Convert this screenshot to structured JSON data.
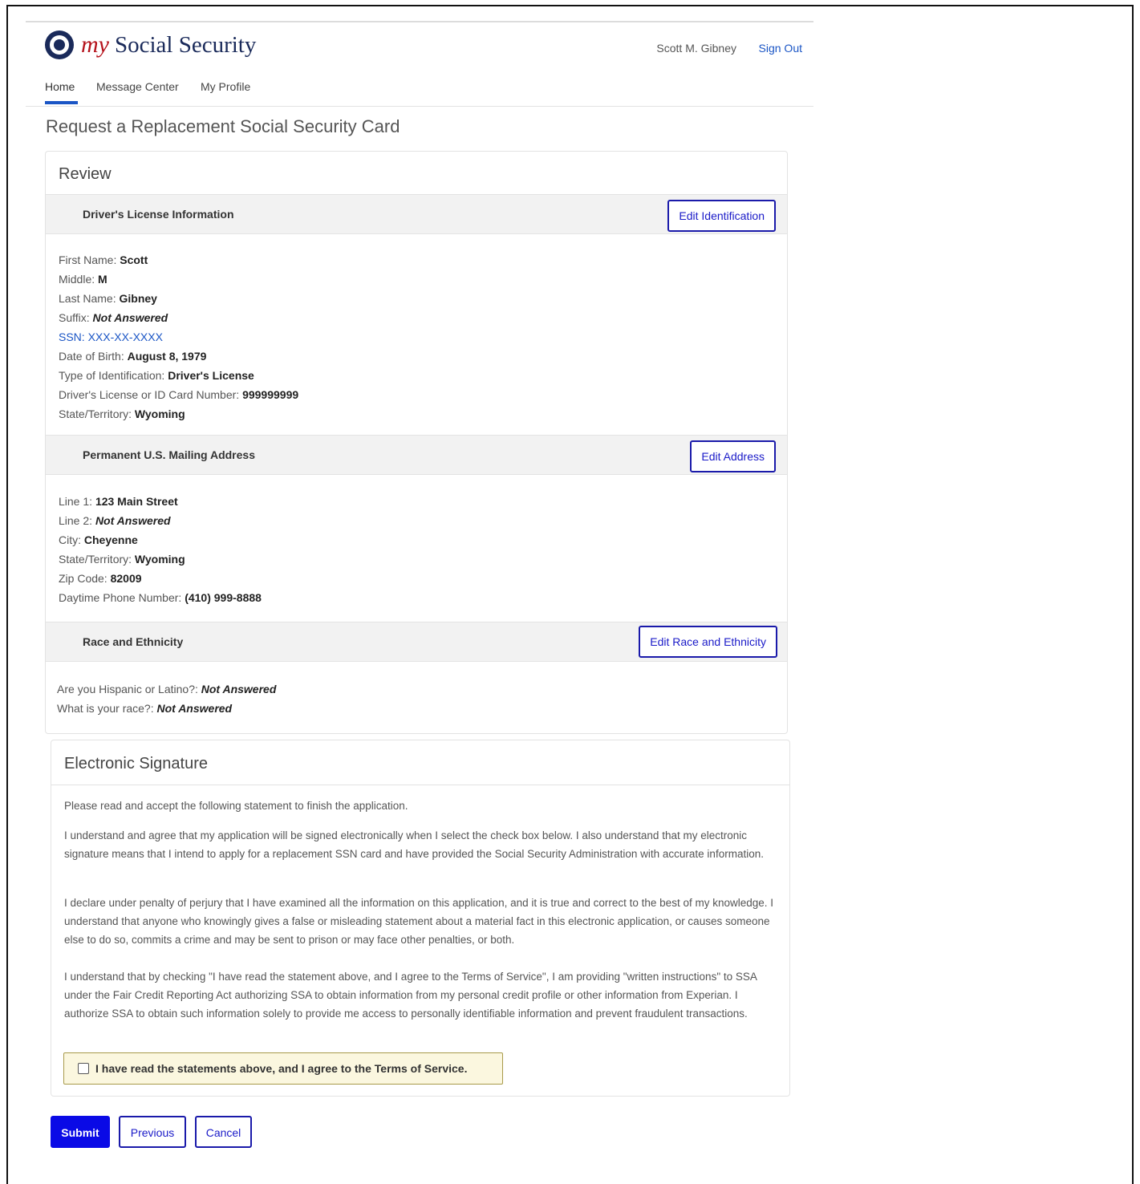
{
  "header": {
    "logo_my": "my",
    "logo_text": "Social Security",
    "user_name": "Scott M. Gibney",
    "sign_out": "Sign Out"
  },
  "nav": {
    "items": [
      {
        "label": "Home",
        "active": true
      },
      {
        "label": "Message Center",
        "active": false
      },
      {
        "label": "My Profile",
        "active": false
      }
    ]
  },
  "page_title": "Request a Replacement Social Security Card",
  "review": {
    "title": "Review",
    "drivers_license": {
      "heading": "Driver's License Information",
      "edit_label": "Edit Identification",
      "fields": [
        {
          "label": "First Name: ",
          "value": "Scott"
        },
        {
          "label": "Middle: ",
          "value": "M"
        },
        {
          "label": "Last Name: ",
          "value": "Gibney"
        },
        {
          "label": "Suffix: ",
          "value": "Not Answered"
        },
        {
          "label": "SSN: ",
          "value": "XXX-XX-XXXX"
        },
        {
          "label": "Date of Birth: ",
          "value": "August 8, 1979"
        },
        {
          "label": "Type of Identification: ",
          "value": "Driver's License"
        },
        {
          "label": "Driver's License or ID Card Number: ",
          "value": "999999999"
        },
        {
          "label": "State/Territory: ",
          "value": "Wyoming"
        }
      ]
    },
    "mailing_address": {
      "heading": "Permanent U.S. Mailing Address",
      "edit_label": "Edit Address",
      "fields": [
        {
          "label": "Line 1: ",
          "value": "123 Main Street"
        },
        {
          "label": "Line 2: ",
          "value": "Not Answered"
        },
        {
          "label": "City: ",
          "value": "Cheyenne"
        },
        {
          "label": "State/Territory: ",
          "value": "Wyoming"
        },
        {
          "label": "Zip Code: ",
          "value": "82009"
        },
        {
          "label": "Daytime Phone Number: ",
          "value": "(410) 999-8888"
        }
      ]
    },
    "race_ethnicity": {
      "heading": "Race and Ethnicity",
      "edit_label": "Edit Race and Ethnicity",
      "fields": [
        {
          "label": "Are you Hispanic or Latino?: ",
          "value": "Not Answered"
        },
        {
          "label": "What is your race?: ",
          "value": "Not Answered"
        }
      ]
    }
  },
  "signature": {
    "title": "Electronic Signature",
    "intro": "Please read and accept the following statement to finish the application.",
    "para1": "I understand and agree that my application will be signed electronically when I select the check box below. I also understand that my electronic signature means that I intend to apply for a replacement SSN card and have provided the Social Security Administration with accurate information.",
    "para2": "I declare under penalty of perjury that I have examined all the information on this application, and it is true and correct to the best of my knowledge. I understand that anyone who knowingly gives a false or misleading statement about a material fact in this electronic application, or causes someone else to do so, commits a crime and may be sent to prison or may face other penalties, or both.",
    "para3": "I understand that by checking \"I have read the statement above, and I agree to the Terms of Service\", I am providing \"written instructions\" to SSA under the Fair Credit Reporting Act authorizing SSA to obtain information from my personal credit profile or other information from Experian. I authorize SSA to obtain such information solely to provide me access to personally identifiable information and prevent fraudulent transactions.",
    "agree_label": "I have read the statements above, and I agree to the Terms of Service.",
    "agree_checked": false
  },
  "actions": {
    "submit": "Submit",
    "previous": "Previous",
    "cancel": "Cancel"
  },
  "colors": {
    "link": "#1a55c5",
    "primary_button": "#0a0ae6",
    "logo_red": "#b5121b",
    "logo_navy": "#1a2a5a",
    "agree_bg": "#fbf7df"
  }
}
